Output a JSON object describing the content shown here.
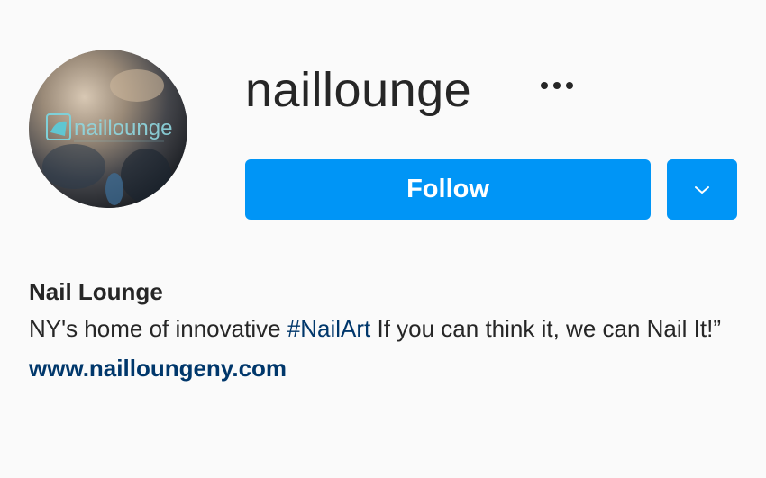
{
  "profile": {
    "username": "naillounge",
    "avatar_icon": "nail-lounge-logo-avatar",
    "avatar_logo_text": "naillounge",
    "more_icon": "more-options-icon"
  },
  "actions": {
    "follow_label": "Follow",
    "dropdown_icon": "chevron-down-icon",
    "accent_color": "#0095f6"
  },
  "bio": {
    "full_name": "Nail Lounge",
    "text_before": "NY's home of innovative ",
    "hashtag": "#NailArt",
    "text_after": " If you can think it, we can Nail It!”",
    "website": "www.nailloungeny.com",
    "link_color": "#00376b"
  }
}
